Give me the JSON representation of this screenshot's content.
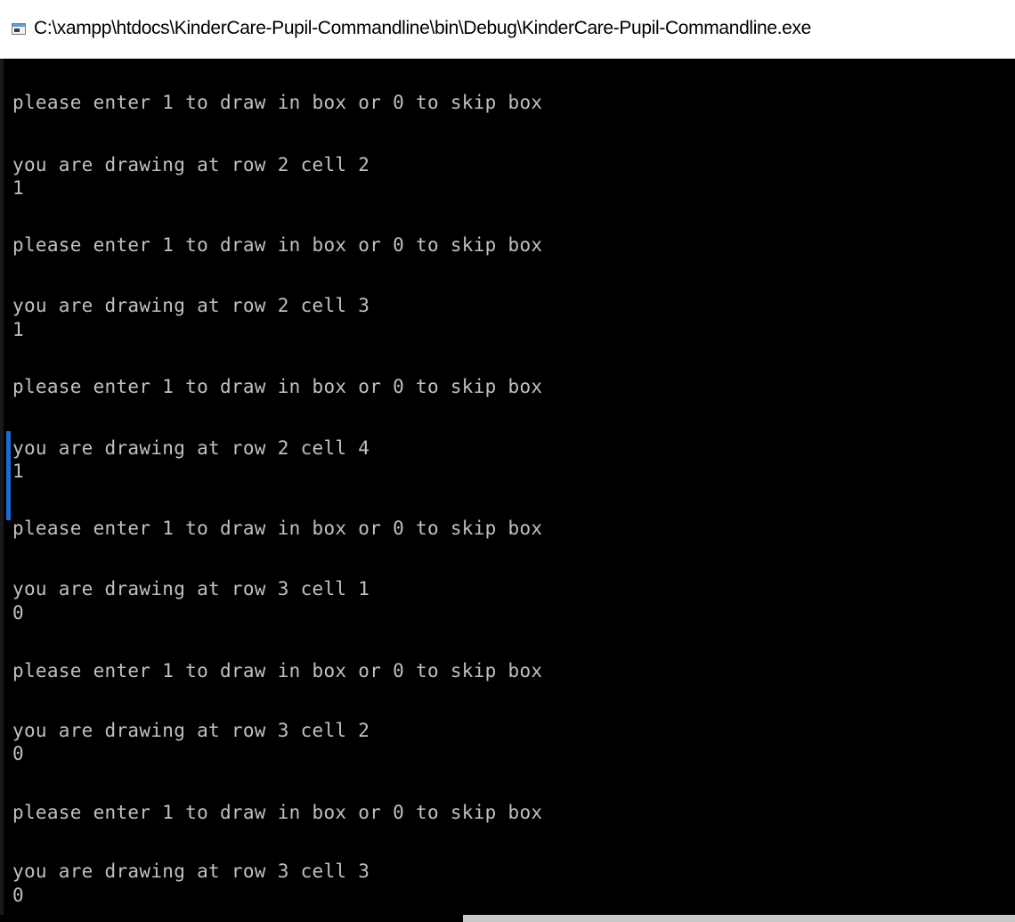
{
  "window": {
    "title": "C:\\xampp\\htdocs\\KinderCare-Pupil-Commandline\\bin\\Debug\\KinderCare-Pupil-Commandline.exe",
    "icon": "console-app-icon"
  },
  "console": {
    "lines": [
      "please enter 1 to draw in box or 0 to skip box",
      "you are drawing at row 2 cell 2",
      "1",
      "please enter 1 to draw in box or 0 to skip box",
      "you are drawing at row 2 cell 3",
      "1",
      "please enter 1 to draw in box or 0 to skip box",
      "you are drawing at row 2 cell 4",
      "1",
      "please enter 1 to draw in box or 0 to skip box",
      "you are drawing at row 3 cell 1",
      "0",
      "please enter 1 to draw in box or 0 to skip box",
      "you are drawing at row 3 cell 2",
      "0",
      "please enter 1 to draw in box or 0 to skip box",
      "you are drawing at row 3 cell 3",
      "0"
    ]
  },
  "colors": {
    "console_background": "#000000",
    "console_text": "#C0C0C0",
    "titlebar_background": "#FFFFFF",
    "selection_accent": "#1E6BD6"
  }
}
